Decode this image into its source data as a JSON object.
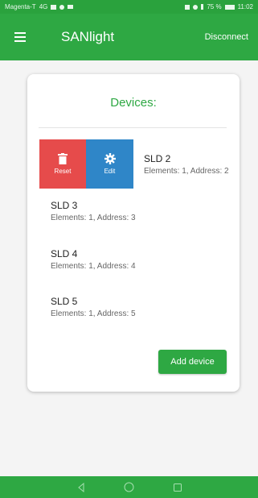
{
  "status_bar": {
    "carrier": "Magenta-T",
    "network": "4G",
    "battery": "75 %",
    "time": "11:02"
  },
  "app_bar": {
    "title": "SANlight",
    "disconnect_label": "Disconnect"
  },
  "card": {
    "title": "Devices:",
    "swipe_actions": {
      "reset_label": "Reset",
      "edit_label": "Edit"
    },
    "devices": [
      {
        "name": "SLD 2",
        "detail": "Elements: 1, Address: 2"
      },
      {
        "name": "SLD 3",
        "detail": "Elements: 1, Address: 3"
      },
      {
        "name": "SLD 4",
        "detail": "Elements: 1, Address: 4"
      },
      {
        "name": "SLD 5",
        "detail": "Elements: 1, Address: 5"
      }
    ],
    "add_device_label": "Add device"
  },
  "colors": {
    "primary_green": "#2ea843",
    "reset_red": "#e64b4b",
    "edit_blue": "#2f86c8"
  },
  "icons": {
    "menu": "hamburger-menu-icon",
    "reset": "trash-icon",
    "edit": "gear-icon",
    "nav_back": "triangle-back-icon",
    "nav_home": "circle-home-icon",
    "nav_recent": "square-recent-icon"
  }
}
